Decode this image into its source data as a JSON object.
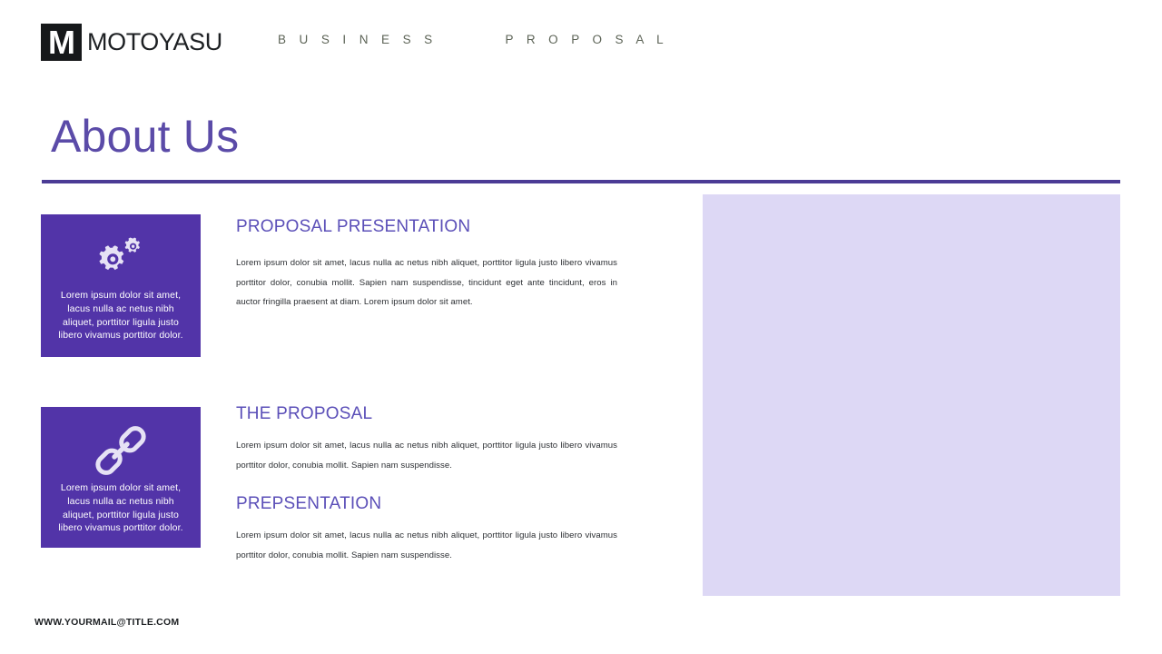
{
  "header": {
    "logo_letter": "M",
    "brand_name": "MOTOYASU",
    "nav": [
      {
        "label": "B U S I N E S S"
      },
      {
        "label": "P R O P O S A L"
      }
    ]
  },
  "title": {
    "text": "About Us"
  },
  "cards": [
    {
      "icon": "gears-icon",
      "text": "Lorem ipsum dolor sit amet, lacus nulla ac netus nibh aliquet, porttitor ligula justo libero vivamus porttitor dolor."
    },
    {
      "icon": "link-icon",
      "text": "Lorem ipsum dolor sit amet, lacus nulla ac netus nibh aliquet, porttitor ligula justo libero vivamus porttitor dolor."
    }
  ],
  "sections": [
    {
      "heading": "PROPOSAL PRESENTATION",
      "body": "Lorem ipsum dolor sit amet, lacus nulla ac netus nibh aliquet, porttitor ligula justo libero vivamus porttitor dolor, conubia mollit. Sapien nam suspendisse, tincidunt eget ante tincidunt, eros in auctor fringilla praesent at diam. Lorem ipsum dolor sit amet."
    },
    {
      "heading": "THE PROPOSAL",
      "body": "Lorem ipsum dolor sit amet, lacus nulla ac netus nibh aliquet, porttitor ligula justo libero vivamus porttitor dolor, conubia mollit. Sapien nam suspendisse."
    },
    {
      "heading": "PREPSENTATION",
      "body": "Lorem ipsum dolor sit amet, lacus nulla ac netus nibh aliquet, porttitor ligula justo libero vivamus porttitor dolor, conubia mollit. Sapien nam suspendisse."
    }
  ],
  "footer": {
    "mail": "WWW.YOURMAIL@TITLE.COM"
  },
  "colors": {
    "card_purple": "#5234a8",
    "title_purple": "#5b4ba8",
    "rule_purple": "#4b3b95",
    "heading_purple": "#5b4fb8",
    "placeholder_lavender": "#ddd8f5",
    "nav_olive": "#5d6457",
    "logo_black": "#16181a"
  }
}
